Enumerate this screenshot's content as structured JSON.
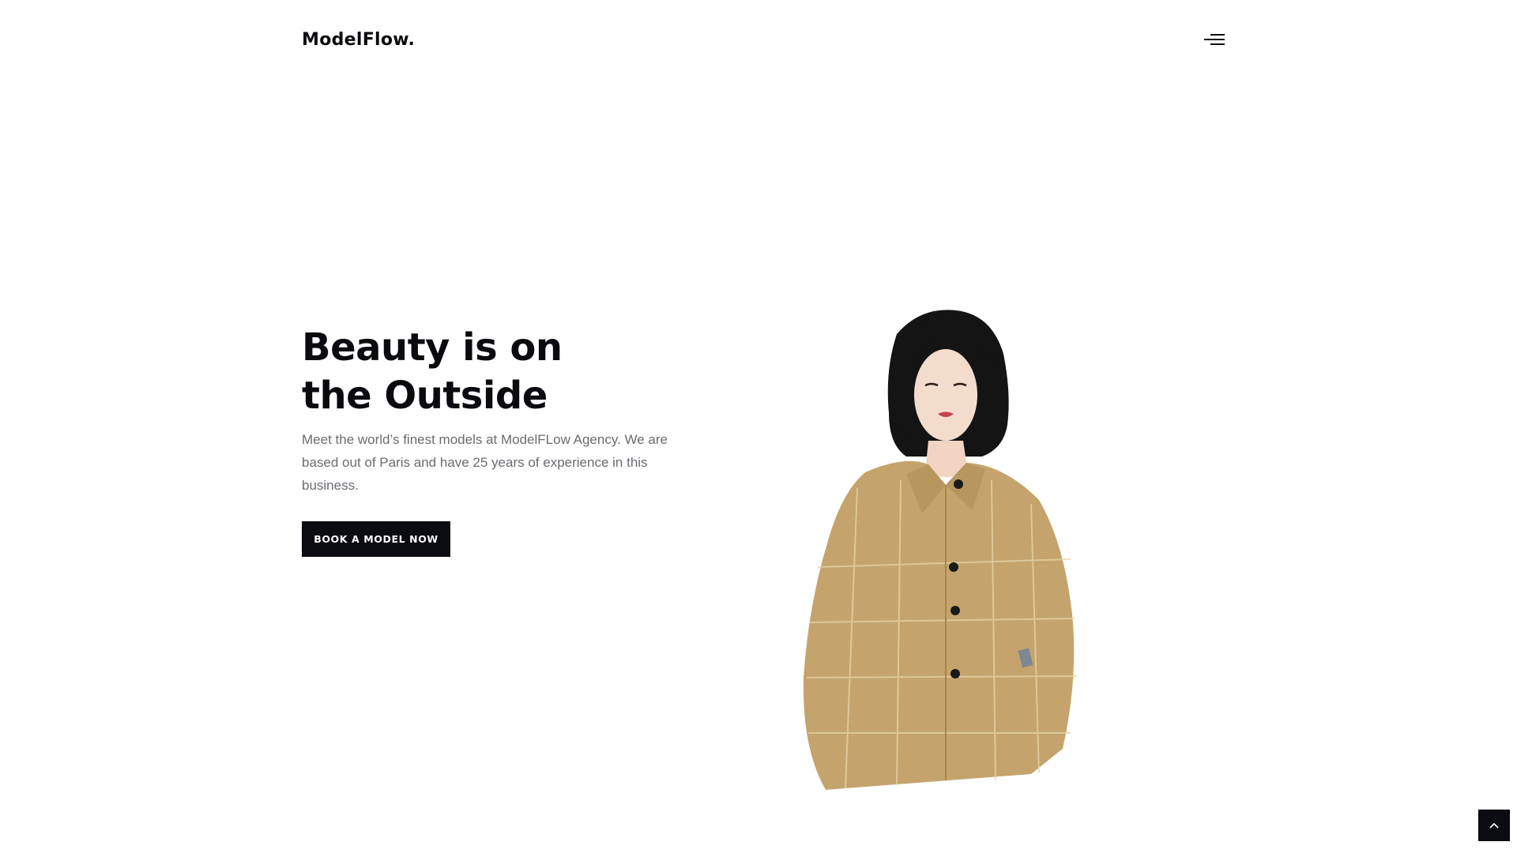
{
  "header": {
    "logo": "ModelFlow.",
    "menu_icon": "hamburger-menu-icon"
  },
  "hero": {
    "headline_line1": "Beauty is on",
    "headline_line2": "the Outside",
    "intro": "Meet the world’s finest models at ModelFLow Agency. We are based out of Paris and have 25 years of experience in this business.",
    "cta_label": "BOOK A MODEL NOW",
    "image_subject": "model-in-checked-jacket"
  },
  "footer_controls": {
    "back_to_top_icon": "chevron-up-icon"
  },
  "colors": {
    "text": "#0b0b0f",
    "muted_text": "#6b6b73",
    "button_bg": "#0b0b12",
    "background": "#ffffff",
    "jacket": "#c4a46c"
  }
}
